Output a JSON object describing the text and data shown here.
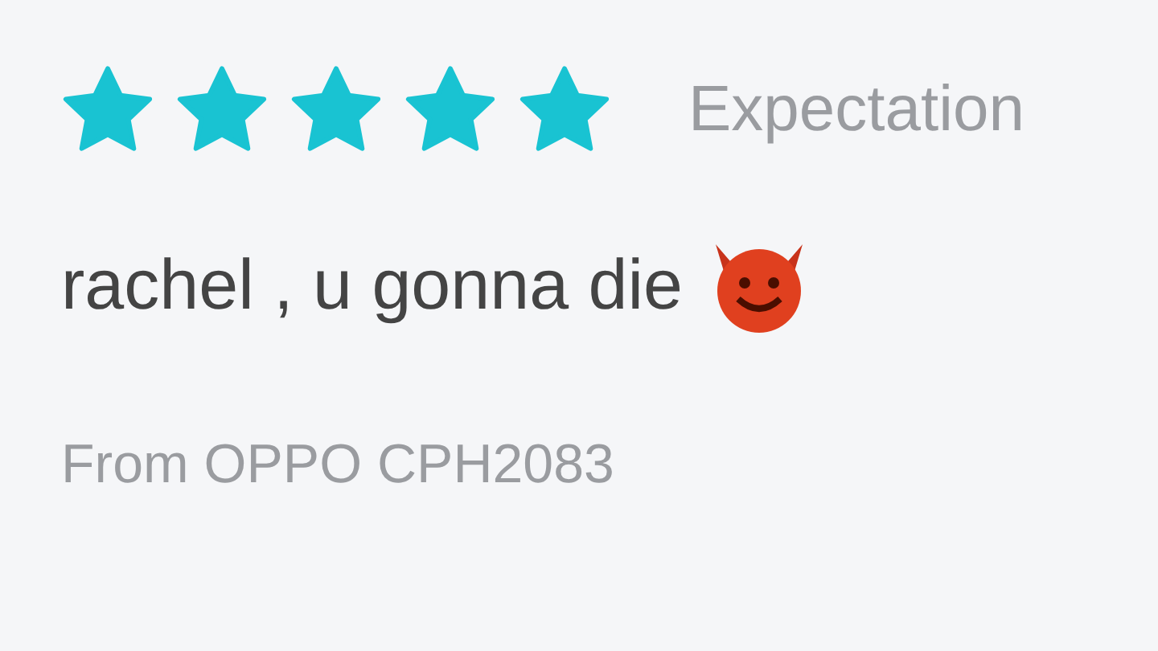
{
  "review": {
    "stars": 5,
    "rating_label": "Expectation",
    "comment": "rachel , u gonna die",
    "device": "From OPPO CPH2083"
  }
}
